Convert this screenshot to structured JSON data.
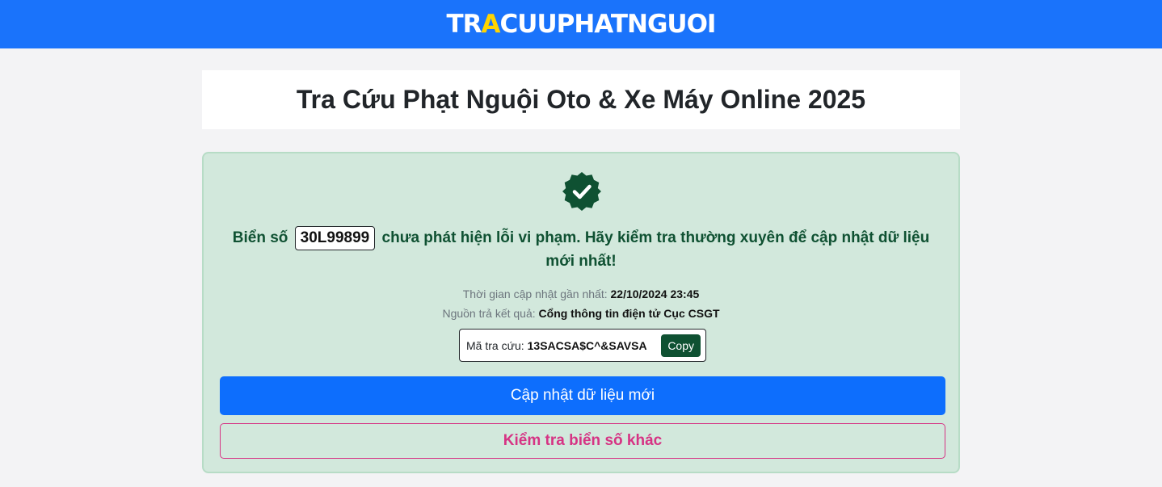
{
  "header": {
    "logo_part1": "TR",
    "logo_accent": "A",
    "logo_part2": "CUUPHATNGUOI"
  },
  "page": {
    "title": "Tra Cứu Phạt Nguội Oto & Xe Máy Online 2025"
  },
  "result": {
    "status_icon": "verified-badge-check-icon",
    "message_prefix": "Biển số",
    "plate": "30L99899",
    "message_suffix": "chưa phát hiện lỗi vi phạm. Hãy kiểm tra thường xuyên để cập nhật dữ liệu mới nhất!",
    "updated_label": "Thời gian cập nhật gần nhất:",
    "updated_value": "22/10/2024 23:45",
    "source_label": "Nguồn trả kết quả:",
    "source_value": "Cổng thông tin điện tử Cục CSGT",
    "code_label": "Mã tra cứu:",
    "code_value": "13SACSA$C^&SAVSA",
    "copy_label": "Copy"
  },
  "actions": {
    "refresh_label": "Cập nhật dữ liệu mới",
    "check_other_label": "Kiểm tra biển số khác"
  },
  "colors": {
    "header_bg": "#1a73fb",
    "logo_accent": "#ffd400",
    "success_bg": "#d2e8dc",
    "success_text": "#0f5132",
    "primary": "#0d6efd",
    "danger_outline": "#d63384"
  }
}
